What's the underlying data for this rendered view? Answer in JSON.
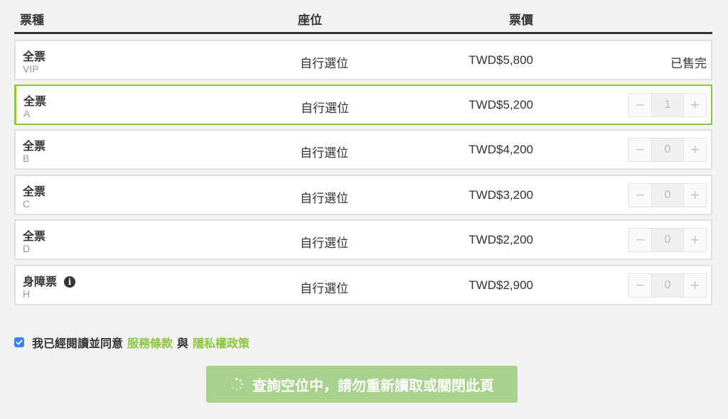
{
  "header": {
    "type": "票種",
    "seat": "座位",
    "price": "票價"
  },
  "tickets": [
    {
      "name": "全票",
      "sub": "VIP",
      "seat": "自行選位",
      "price": "TWD$5,800",
      "status": "已售完"
    },
    {
      "name": "全票",
      "sub": "A",
      "seat": "自行選位",
      "price": "TWD$5,200",
      "qty": "1"
    },
    {
      "name": "全票",
      "sub": "B",
      "seat": "自行選位",
      "price": "TWD$4,200",
      "qty": "0"
    },
    {
      "name": "全票",
      "sub": "C",
      "seat": "自行選位",
      "price": "TWD$3,200",
      "qty": "0"
    },
    {
      "name": "全票",
      "sub": "D",
      "seat": "自行選位",
      "price": "TWD$2,200",
      "qty": "0"
    },
    {
      "name": "身障票",
      "sub": "H",
      "seat": "自行選位",
      "price": "TWD$2,900",
      "qty": "0",
      "info": "i"
    }
  ],
  "stepper": {
    "minus": "−",
    "plus": "+"
  },
  "agreement": {
    "checked": true,
    "text": "我已經閱讀並同意",
    "terms": "服務條款",
    "and": "與",
    "privacy": "隱私權政策"
  },
  "submit": {
    "label": "查詢空位中，請勿重新讀取或關閉此頁"
  },
  "colors": {
    "accent": "#8cc63f",
    "button_bg": "#a9d18e",
    "checkbox": "#3b82f6"
  }
}
